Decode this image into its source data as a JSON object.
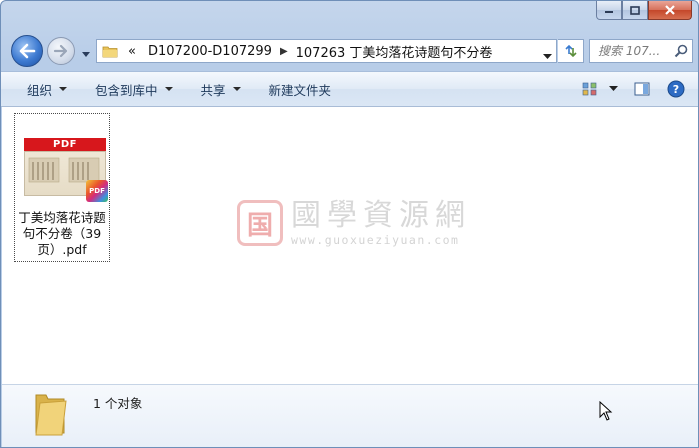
{
  "navigation": {
    "breadcrumbs": [
      {
        "label": "«"
      },
      {
        "label": "D107200-D107299"
      },
      {
        "label": "107263 丁美均落花诗题句不分卷"
      }
    ]
  },
  "search": {
    "placeholder": "搜索 107..."
  },
  "toolbar": {
    "organize_label": "组织",
    "include_in_library_label": "包含到库中",
    "share_label": "共享",
    "new_folder_label": "新建文件夹"
  },
  "files": [
    {
      "name": "丁美均落花诗题句不分卷（39页）.pdf",
      "thumb_header": "PDF",
      "badge": "PDF"
    }
  ],
  "watermark": {
    "seal": "国",
    "chinese": "國學資源網",
    "url": "www.guoxueziyuan.com"
  },
  "details": {
    "count_text": "1 个对象"
  },
  "colors": {
    "pdf_red": "#d7171c",
    "toolbar_text": "#1e395b",
    "back_blue": "#3d7ad1"
  }
}
